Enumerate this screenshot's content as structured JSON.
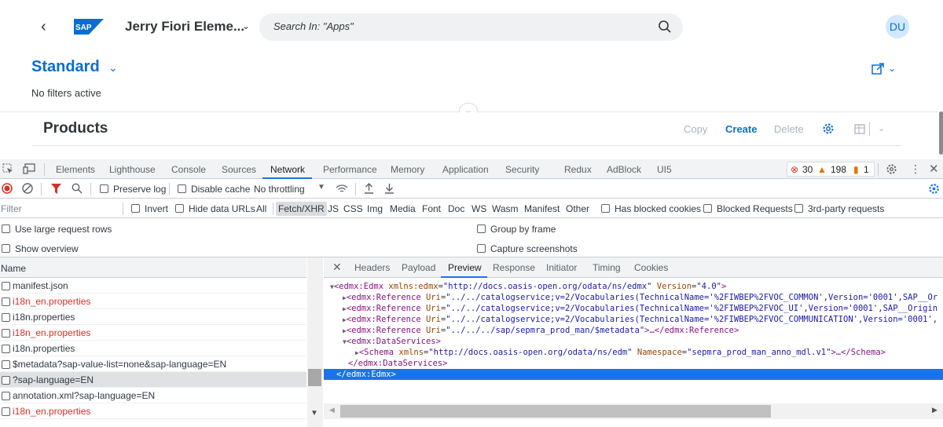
{
  "shell": {
    "app_title": "Jerry Fiori Eleme...",
    "search_placeholder": "Search In: \"Apps\"",
    "avatar_initials": "DU",
    "logo_text": "SAP"
  },
  "page": {
    "variant": "Standard",
    "filter_status": "No filters active",
    "table_title": "Products",
    "actions": {
      "copy": "Copy",
      "create": "Create",
      "delete": "Delete"
    }
  },
  "devtools": {
    "tabs": [
      "Elements",
      "Lighthouse",
      "Console",
      "Sources",
      "Network",
      "Performance",
      "Memory",
      "Application",
      "Security",
      "Redux",
      "AdBlock",
      "UI5"
    ],
    "active_tab": "Network",
    "errors": "30",
    "warnings": "198",
    "info": "1",
    "controls": {
      "preserve_log": "Preserve log",
      "disable_cache": "Disable cache",
      "throttling": "No throttling"
    },
    "filter": {
      "placeholder": "Filter",
      "invert": "Invert",
      "hide_data_urls": "Hide data URLs",
      "types": [
        "All",
        "Fetch/XHR",
        "JS",
        "CSS",
        "Img",
        "Media",
        "Font",
        "Doc",
        "WS",
        "Wasm",
        "Manifest",
        "Other"
      ],
      "active_type": "Fetch/XHR",
      "blocked_cookies": "Has blocked cookies",
      "blocked_requests": "Blocked Requests",
      "third_party": "3rd-party requests"
    },
    "options": {
      "large_rows": "Use large request rows",
      "group_by_frame": "Group by frame",
      "show_overview": "Show overview",
      "capture_screenshots": "Capture screenshots"
    },
    "list_header": "Name",
    "requests": [
      {
        "name": "manifest.json",
        "error": false
      },
      {
        "name": "i18n_en.properties",
        "error": true
      },
      {
        "name": "i18n.properties",
        "error": false
      },
      {
        "name": "i18n_en.properties",
        "error": true
      },
      {
        "name": "i18n.properties",
        "error": false
      },
      {
        "name": "$metadata?sap-value-list=none&sap-language=EN",
        "error": false
      },
      {
        "name": "?sap-language=EN",
        "error": false
      },
      {
        "name": "annotation.xml?sap-language=EN",
        "error": false
      },
      {
        "name": "i18n_en.properties",
        "error": true
      }
    ],
    "selected_request_index": 6,
    "detail_tabs": [
      "Headers",
      "Payload",
      "Preview",
      "Response",
      "Initiator",
      "Timing",
      "Cookies"
    ],
    "active_detail_tab": "Preview",
    "preview": {
      "l1_tag": "<edmx:Edmx",
      "l1_attr1": "xmlns:edmx",
      "l1_val1": "\"http://docs.oasis-open.org/odata/ns/edmx\"",
      "l1_attr2": "Version",
      "l1_val2": "\"4.0\"",
      "ref_tag": "<edmx:Reference",
      "ref_attr": "Uri",
      "ref1_val": "\"../../catalogservice;v=2/Vocabularies(TechnicalName='%2FIWBEP%2FVOC_COMMON',Version='0001',SAP__Or",
      "ref2_val": "\"../../catalogservice;v=2/Vocabularies(TechnicalName='%2FIWBEP%2FVOC_UI',Version='0001',SAP__Origin",
      "ref3_val": "\"../../catalogservice;v=2/Vocabularies(TechnicalName='%2FIWBEP%2FVOC_COMMUNICATION',Version='0001',",
      "ref4_val": "\"../../../sap/sepmra_prod_man/$metadata\"",
      "ref4_tail": "…</edmx:Reference>",
      "ds_open": "<edmx:DataServices>",
      "schema_tag": "<Schema",
      "schema_attr1": "xmlns",
      "schema_val1": "\"http://docs.oasis-open.org/odata/ns/edm\"",
      "schema_attr2": "Namespace",
      "schema_val2": "\"sepmra_prod_man_anno_mdl.v1\"",
      "schema_tail": "…</Schema>",
      "ds_close": "</edmx:DataServices>",
      "edmx_close": "</edmx:Edmx>"
    }
  }
}
